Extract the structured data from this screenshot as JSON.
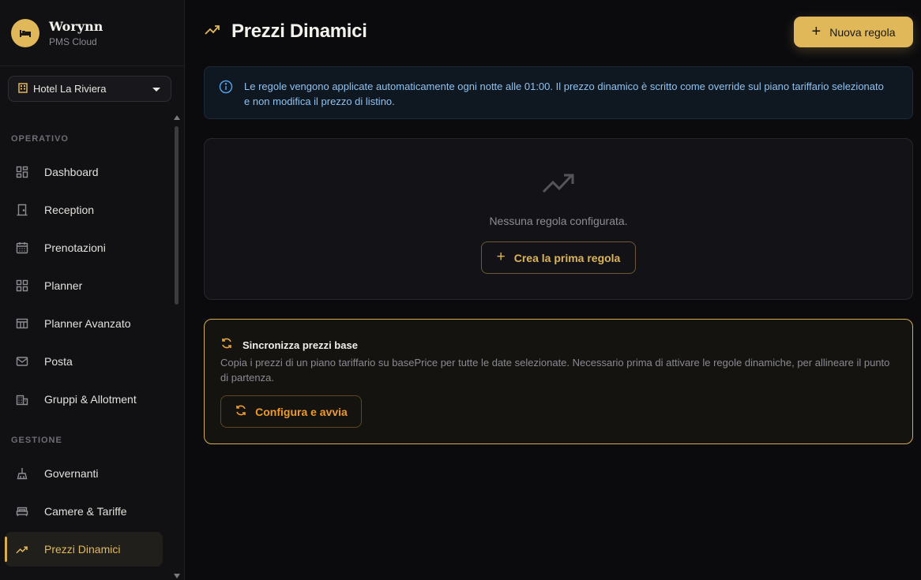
{
  "brand": {
    "name": "Worynn",
    "subtitle": "PMS Cloud"
  },
  "hotel_selector": {
    "value": "Hotel La Riviera"
  },
  "sidebar": {
    "sections": [
      {
        "title": "OPERATIVO"
      },
      {
        "title": "GESTIONE"
      }
    ],
    "items": [
      {
        "label": "Dashboard",
        "icon": "dashboard-icon"
      },
      {
        "label": "Reception",
        "icon": "door-icon"
      },
      {
        "label": "Prenotazioni",
        "icon": "calendar-icon"
      },
      {
        "label": "Planner",
        "icon": "grid-icon"
      },
      {
        "label": "Planner Avanzato",
        "icon": "layout-icon"
      },
      {
        "label": "Posta",
        "icon": "mail-icon"
      },
      {
        "label": "Gruppi & Allotment",
        "icon": "building-icon"
      },
      {
        "label": "Governanti",
        "icon": "broom-icon"
      },
      {
        "label": "Camere & Tariffe",
        "icon": "bed-icon"
      },
      {
        "label": "Prezzi Dinamici",
        "icon": "trending-up-icon",
        "active": true
      }
    ]
  },
  "header": {
    "title": "Prezzi Dinamici",
    "new_rule_label": "Nuova regola"
  },
  "info": {
    "text": "Le regole vengono applicate automaticamente ogni notte alle 01:00. Il prezzo dinamico è scritto come override sul piano tariffario selezionato e non modifica il prezzo di listino."
  },
  "empty_state": {
    "message": "Nessuna regola configurata.",
    "button_label": "Crea la prima regola"
  },
  "sync": {
    "title": "Sincronizza prezzi base",
    "description": "Copia i prezzi di un piano tariffario su basePrice per tutte le date selezionate. Necessario prima di attivare le regole dinamiche, per allineare il punto di partenza.",
    "button_label": "Configura e avvia"
  },
  "colors": {
    "accent": "#e0b85a",
    "sync_border": "#d4ad55",
    "sync_button_text": "#ee9a2c",
    "info_text": "#8fc2f0"
  }
}
